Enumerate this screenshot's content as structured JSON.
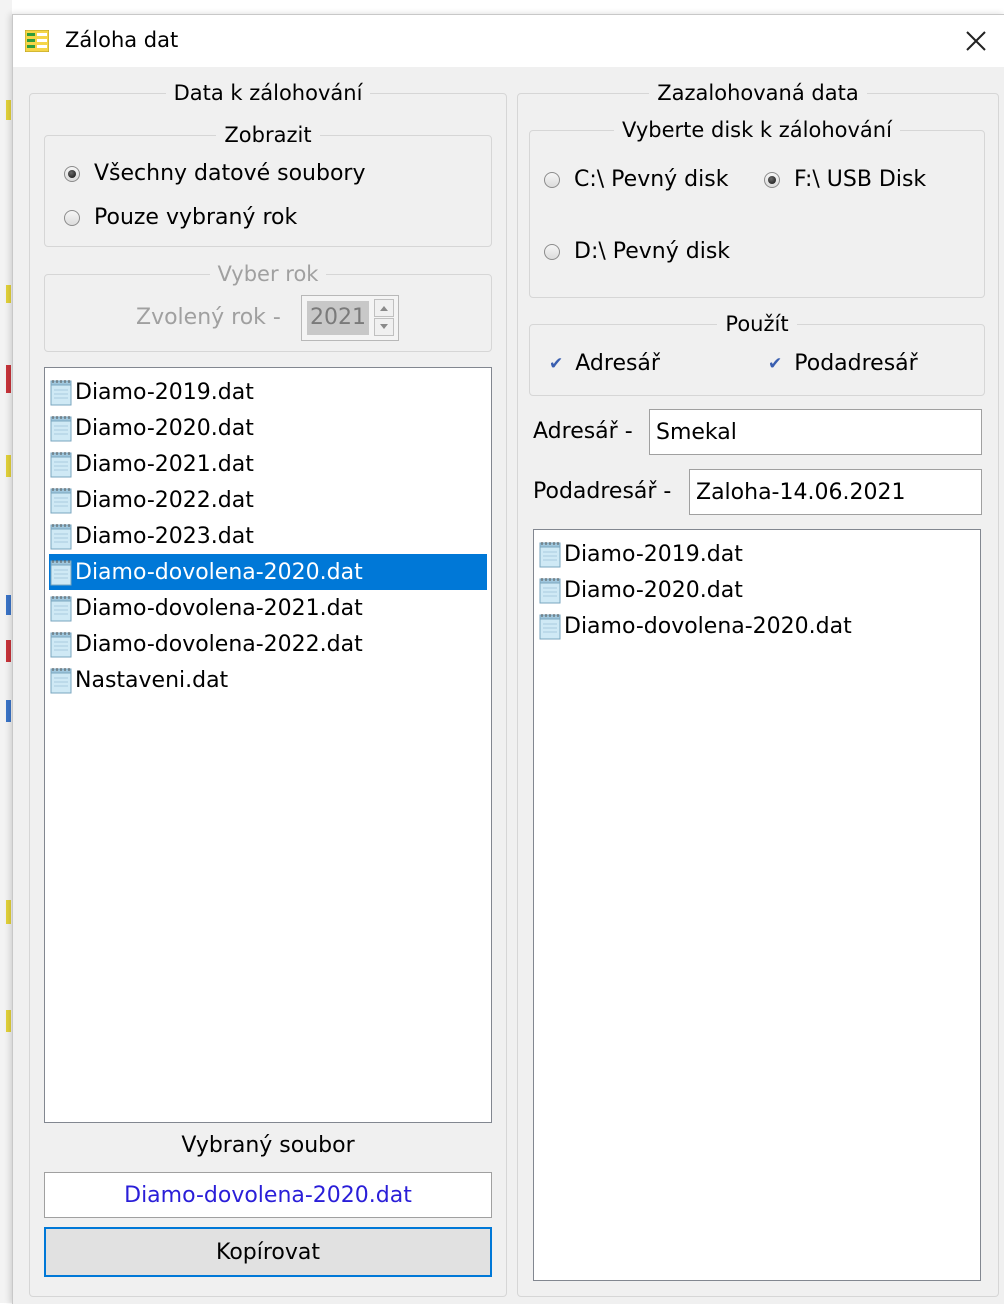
{
  "window": {
    "title": "Záloha dat"
  },
  "left_panel": {
    "title": "Data k zálohování",
    "show_group": {
      "title": "Zobrazit",
      "options": [
        {
          "label": "Všechny datové soubory",
          "selected": true
        },
        {
          "label": "Pouze vybraný rok",
          "selected": false
        }
      ]
    },
    "year_group": {
      "title": "Vyber rok",
      "year_label": "Zvolený rok -",
      "year_value": "2021"
    },
    "files": [
      "Diamo-2019.dat",
      "Diamo-2020.dat",
      "Diamo-2021.dat",
      "Diamo-2022.dat",
      "Diamo-2023.dat",
      "Diamo-dovolena-2020.dat",
      "Diamo-dovolena-2021.dat",
      "Diamo-dovolena-2022.dat",
      "Nastaveni.dat"
    ],
    "selected_index": 5,
    "selected_file_label": "Vybraný soubor",
    "selected_file_value": "Diamo-dovolena-2020.dat",
    "copy_button": "Kopírovat"
  },
  "right_panel": {
    "title": "Zazalohovaná data",
    "disk_group": {
      "title": "Vyberte disk k zálohování",
      "options": [
        {
          "label": "C:\\ Pevný disk",
          "selected": false
        },
        {
          "label": "F:\\ USB Disk",
          "selected": true
        },
        {
          "label": "D:\\ Pevný disk",
          "selected": false
        }
      ]
    },
    "use_group": {
      "title": "Použít",
      "directory_check": "Adresář",
      "subdirectory_check": "Podadresář"
    },
    "directory_label": "Adresář -",
    "directory_value": "Smekal",
    "subdirectory_label": "Podadresář -",
    "subdirectory_value": "Zaloha-14.06.2021",
    "backup_files": [
      "Diamo-2019.dat",
      "Diamo-2020.dat",
      "Diamo-dovolena-2020.dat"
    ]
  },
  "colors": {
    "selection": "#0078d7",
    "selected_file_text": "#2a1ed8",
    "background": "#f0f0f0"
  }
}
